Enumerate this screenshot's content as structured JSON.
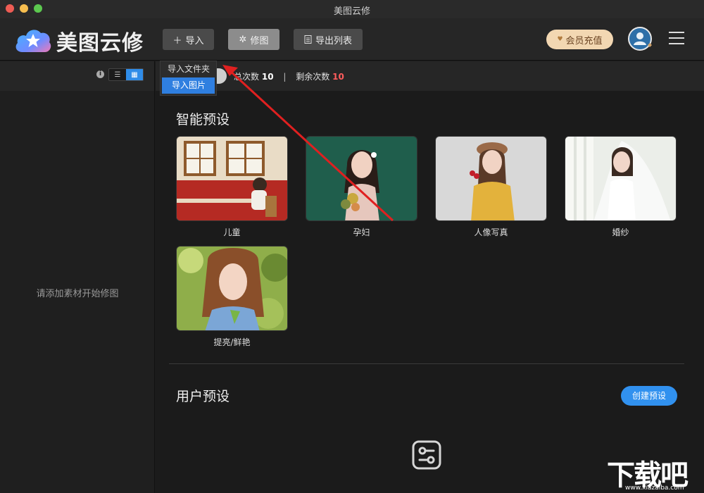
{
  "window": {
    "title": "美图云修"
  },
  "toolbar": {
    "brand": "美图云修",
    "import_label": "导入",
    "retouch_label": "修图",
    "export_list_label": "导出列表",
    "vip_label": "会员充值"
  },
  "import_menu": {
    "items": [
      {
        "label": "导入文件夹",
        "active": false
      },
      {
        "label": "导入图片",
        "active": true
      }
    ]
  },
  "sidebar": {
    "empty_hint": "请添加素材开始修图"
  },
  "usage": {
    "total_label": "总次数",
    "total_value": "10",
    "separator": "|",
    "remaining_label": "剩余次数",
    "remaining_value": "10"
  },
  "smart_presets": {
    "title": "智能预设",
    "items": [
      {
        "label": "儿童"
      },
      {
        "label": "孕妇"
      },
      {
        "label": "人像写真"
      },
      {
        "label": "婚纱"
      },
      {
        "label": "提亮/鲜艳"
      }
    ]
  },
  "user_presets": {
    "title": "用户预设",
    "create_label": "创建预设"
  },
  "watermark": {
    "text": "下载吧",
    "url": "www.xiazaiba.com"
  },
  "colors": {
    "accent": "#2f8ce8",
    "remaining": "#ff5c5c",
    "vip": "#f2d7b2",
    "arrow": "#e02020"
  }
}
